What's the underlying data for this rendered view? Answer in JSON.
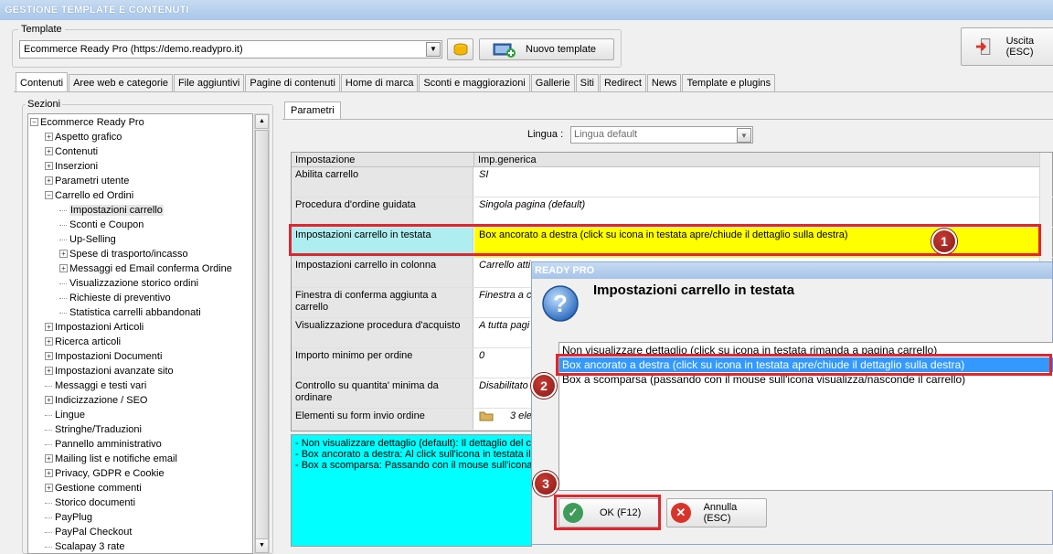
{
  "window": {
    "title": "GESTIONE TEMPLATE E CONTENUTI"
  },
  "template": {
    "label": "Template",
    "selected": "Ecommerce Ready Pro (https://demo.readypro.it)",
    "new_button": "Nuovo template"
  },
  "exit_button": "Uscita (ESC)",
  "tabs": [
    {
      "label": "Contenuti",
      "active": true
    },
    {
      "label": "Aree web e categorie"
    },
    {
      "label": "File aggiuntivi"
    },
    {
      "label": "Pagine di contenuti"
    },
    {
      "label": "Home di marca"
    },
    {
      "label": "Sconti e maggiorazioni"
    },
    {
      "label": "Gallerie"
    },
    {
      "label": "Siti"
    },
    {
      "label": "Redirect"
    },
    {
      "label": "News"
    },
    {
      "label": "Template e plugins"
    }
  ],
  "sections": {
    "label": "Sezioni",
    "root": "Ecommerce Ready Pro",
    "items": [
      {
        "label": "Aspetto grafico",
        "expandable": true,
        "level": 1
      },
      {
        "label": "Contenuti",
        "expandable": true,
        "level": 1
      },
      {
        "label": "Inserzioni",
        "expandable": true,
        "level": 1
      },
      {
        "label": "Parametri utente",
        "expandable": true,
        "level": 1
      },
      {
        "label": "Carrello ed Ordini",
        "expandable": true,
        "expanded": true,
        "level": 1
      },
      {
        "label": "Impostazioni carrello",
        "level": 2,
        "selected": true
      },
      {
        "label": "Sconti e Coupon",
        "level": 2
      },
      {
        "label": "Up-Selling",
        "level": 2
      },
      {
        "label": "Spese di trasporto/incasso",
        "expandable": true,
        "level": 2
      },
      {
        "label": "Messaggi ed Email conferma Ordine",
        "expandable": true,
        "level": 2
      },
      {
        "label": "Visualizzazione storico ordini",
        "level": 2
      },
      {
        "label": "Richieste di preventivo",
        "level": 2
      },
      {
        "label": "Statistica carrelli abbandonati",
        "level": 2
      },
      {
        "label": "Impostazioni Articoli",
        "expandable": true,
        "level": 1
      },
      {
        "label": "Ricerca articoli",
        "expandable": true,
        "level": 1
      },
      {
        "label": "Impostazioni Documenti",
        "expandable": true,
        "level": 1
      },
      {
        "label": "Impostazioni avanzate sito",
        "expandable": true,
        "level": 1
      },
      {
        "label": "Messaggi e testi vari",
        "level": 1
      },
      {
        "label": "Indicizzazione / SEO",
        "expandable": true,
        "level": 1
      },
      {
        "label": "Lingue",
        "level": 1
      },
      {
        "label": "Stringhe/Traduzioni",
        "level": 1
      },
      {
        "label": "Pannello amministrativo",
        "level": 1
      },
      {
        "label": "Mailing list e notifiche email",
        "expandable": true,
        "level": 1
      },
      {
        "label": "Privacy, GDPR e Cookie",
        "expandable": true,
        "level": 1
      },
      {
        "label": "Gestione commenti",
        "expandable": true,
        "level": 1
      },
      {
        "label": "Storico documenti",
        "level": 1
      },
      {
        "label": "PayPlug",
        "level": 1
      },
      {
        "label": "PayPal Checkout",
        "level": 1
      },
      {
        "label": "Scalapay 3 rate",
        "level": 1
      }
    ]
  },
  "parametri": {
    "tab_label": "Parametri",
    "lingua_label": "Lingua :",
    "lingua_value": "Lingua default",
    "col_setting": "Impostazione",
    "col_value": "Imp.generica",
    "rows": [
      {
        "setting": "Abilita carrello",
        "value": "SI"
      },
      {
        "setting": "Procedura d'ordine guidata",
        "value": "Singola pagina (default)"
      },
      {
        "setting": "Impostazioni carrello in testata",
        "value": "Box ancorato a destra (click su icona in testata apre/chiude il dettaglio sulla destra)",
        "highlight": true
      },
      {
        "setting": "Impostazioni carrello in colonna",
        "value": "Carrello atti"
      },
      {
        "setting": "Finestra di conferma aggiunta a carrello",
        "value": "Finestra a c"
      },
      {
        "setting": "Visualizzazione procedura d'acquisto",
        "value": "A tutta pagi"
      },
      {
        "setting": "Importo minimo per ordine",
        "value": "0"
      },
      {
        "setting": "Controllo su quantita' minima da ordinare",
        "value": "Disabilitato"
      },
      {
        "setting": "Elementi su form invio ordine",
        "value": "3 ele"
      }
    ],
    "description": [
      "- Non visualizzare dettaglio (default): Il dettaglio del ca",
      "- Box ancorato a destra: Al click sull'icona in testata il c",
      "- Box a scomparsa: Passando con il mouse sull'icona in"
    ]
  },
  "dialog": {
    "title": "READY PRO",
    "heading": "Impostazioni carrello in testata",
    "options": [
      {
        "label": "Non visualizzare dettaglio (click su icona in testata rimanda a pagina carrello)"
      },
      {
        "label": "Box ancorato a destra (click su icona in testata apre/chiude il dettaglio sulla destra)",
        "selected": true
      },
      {
        "label": "Box a scomparsa (passando con il mouse sull'icona visualizza/nasconde il carrello)"
      }
    ],
    "ok_button": "OK (F12)",
    "cancel_button": "Annulla (ESC)"
  },
  "annotations": [
    "1",
    "2",
    "3"
  ],
  "colors": {
    "highlight_row": "#ffff00",
    "highlight_label": "#aeeef0",
    "annotation_red": "#e0262e",
    "description_bg": "#00ffff",
    "selection": "#3399ff"
  }
}
